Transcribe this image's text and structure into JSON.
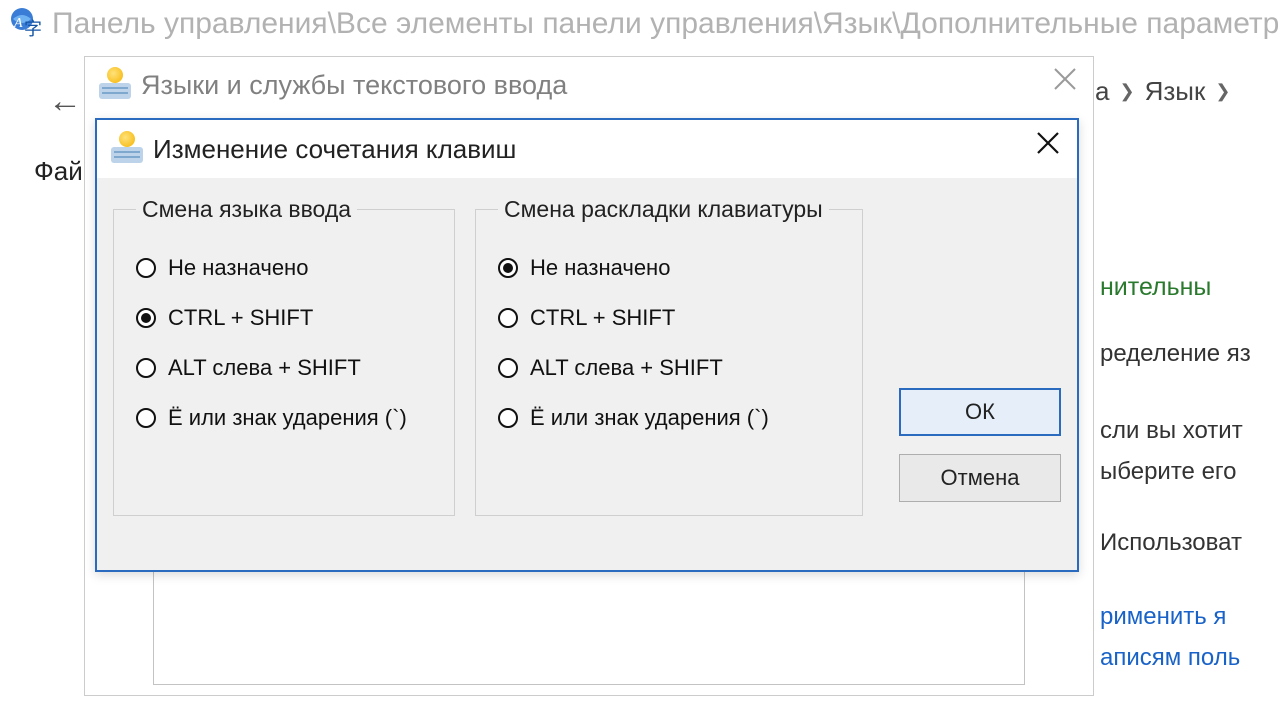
{
  "top_breadcrumb": "Панель управления\\Все элементы панели управления\\Язык\\Дополнительные параметры",
  "back_arrow": "←",
  "menu_file": "Фай",
  "explorer": {
    "crumb_a": "а",
    "crumb_lang": "Язык",
    "heading": "нительны",
    "line1": "ределение яз",
    "line2": "сли вы хотит",
    "line3": "ыберите его",
    "line4": "Использоват",
    "link1": "рименить я",
    "link2": "аписям поль"
  },
  "dialog1": {
    "title": "Языки и службы текстового ввода"
  },
  "dialog2": {
    "title": "Изменение сочетания клавиш",
    "group1": {
      "legend": "Смена языка ввода",
      "options": [
        "Не назначено",
        "CTRL + SHIFT",
        "ALT слева + SHIFT",
        "Ё или знак ударения (`)"
      ],
      "selected_index": 1
    },
    "group2": {
      "legend": "Смена раскладки клавиатуры",
      "options": [
        "Не назначено",
        "CTRL + SHIFT",
        "ALT слева + SHIFT",
        "Ё или знак ударения (`)"
      ],
      "selected_index": 0
    },
    "ok": "ОК",
    "cancel": "Отмена"
  }
}
